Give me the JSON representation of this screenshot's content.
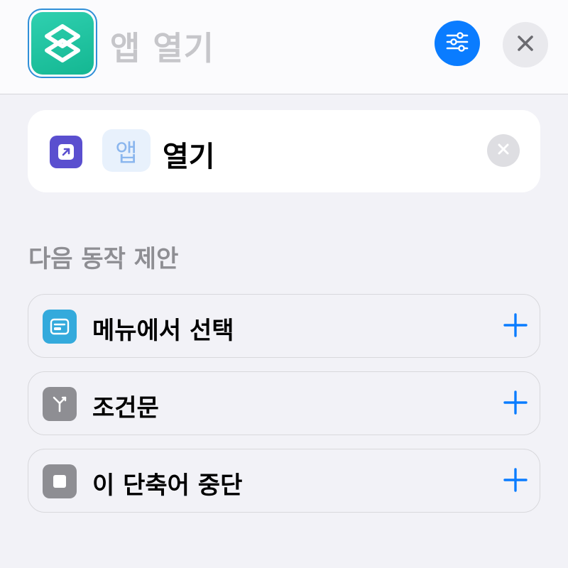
{
  "header": {
    "title": "앱 열기",
    "app_icon": "shortcuts-app-icon",
    "settings_icon": "sliders-icon",
    "close_icon": "close-icon"
  },
  "action": {
    "icon": "open-app-icon",
    "token_label": "앱",
    "verb_label": "열기",
    "clear_icon": "clear-icon"
  },
  "suggestions": {
    "title": "다음 동작 제안",
    "items": [
      {
        "label": "메뉴에서 선택",
        "icon": "menu-icon",
        "color": "#34aadc"
      },
      {
        "label": "조건문",
        "icon": "branch-icon",
        "color": "#8e8e93"
      },
      {
        "label": "이 단축어 중단",
        "icon": "stop-icon",
        "color": "#8e8e93"
      }
    ]
  },
  "colors": {
    "accent": "#0a7cff",
    "app_green": "#14b792",
    "action_purple": "#5a4fcf"
  }
}
